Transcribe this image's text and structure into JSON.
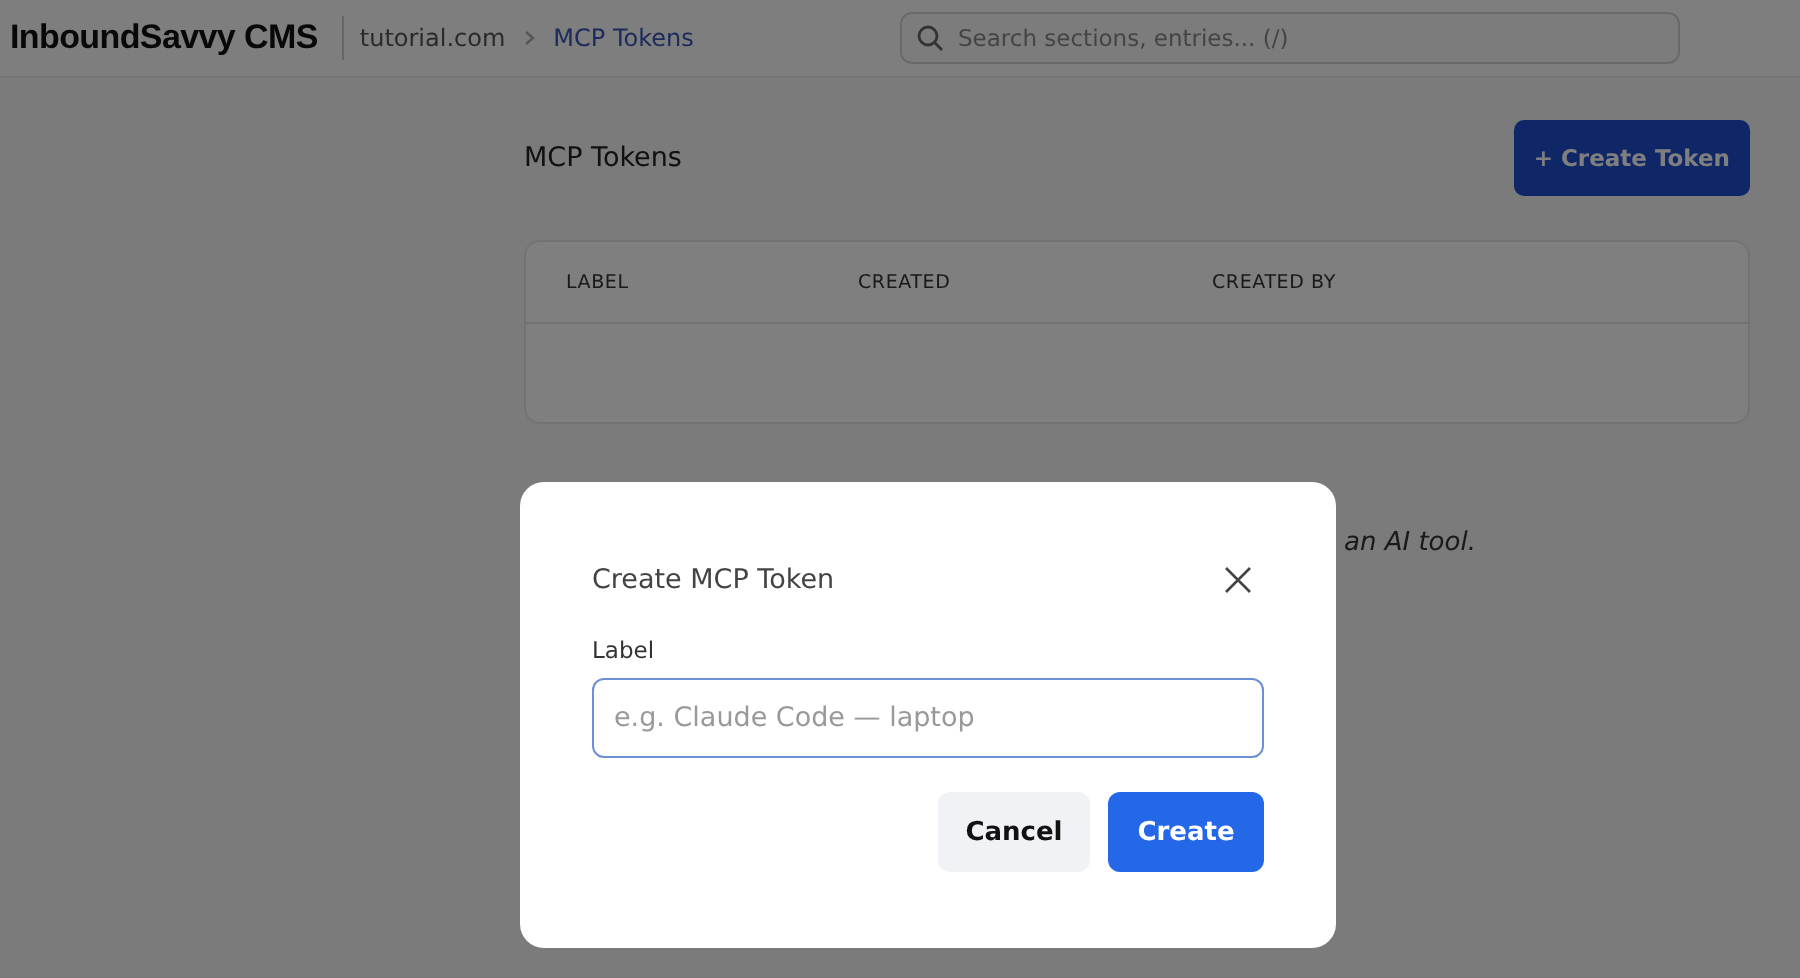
{
  "header": {
    "logo": "InboundSavvy CMS",
    "breadcrumb": [
      {
        "label": "tutorial.com",
        "selected": false
      },
      {
        "label": "MCP Tokens",
        "selected": true
      }
    ],
    "search": {
      "placeholder": "Search sections, entries... (/)"
    }
  },
  "page": {
    "title": "MCP Tokens",
    "create_button": "+ Create Token",
    "table": {
      "columns": [
        "LABEL",
        "CREATED",
        "CREATED BY"
      ]
    },
    "hint": "an AI tool."
  },
  "dialog": {
    "title": "Create MCP Token",
    "field_label": "Label",
    "field_placeholder": "e.g. Claude Code — laptop",
    "buttons": [
      {
        "label": "Cancel",
        "kind": "secondary"
      },
      {
        "label": "Create",
        "kind": "primary"
      }
    ]
  }
}
